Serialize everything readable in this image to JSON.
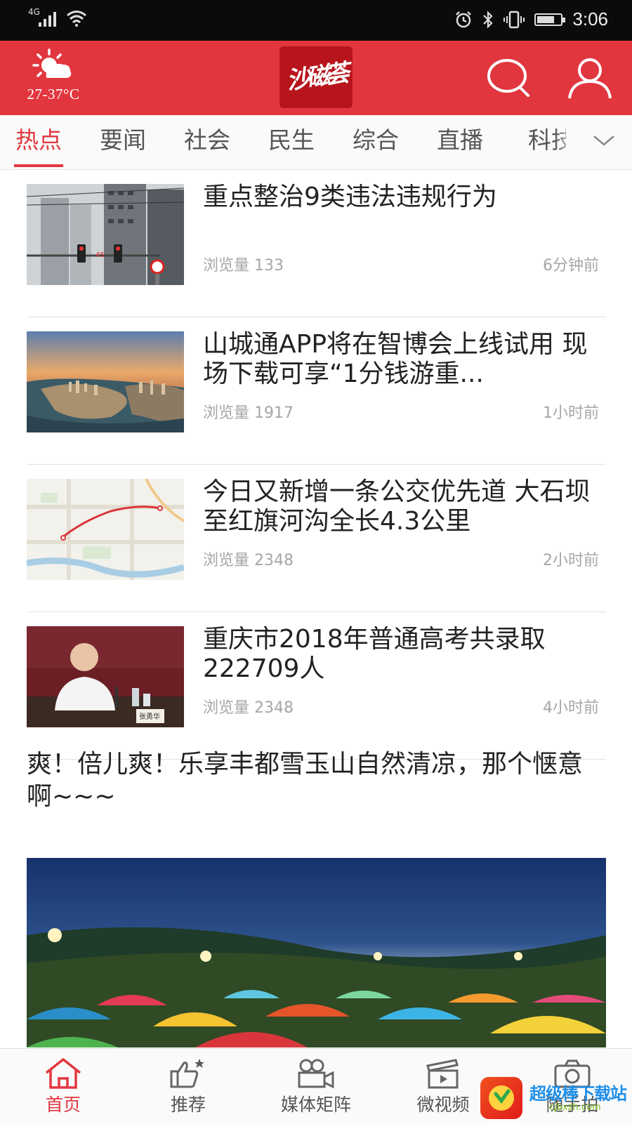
{
  "status_bar": {
    "network": "4G",
    "time": "3:06",
    "battery_level": 0.75
  },
  "header": {
    "weather_temp": "27-37°C",
    "weather_icon": "partly-sunny-icon",
    "logo_text": "沙磁荟",
    "search_icon": "search-icon",
    "user_icon": "user-icon",
    "colors": {
      "brand_red": "#e2363f",
      "logo_red": "#b8141c"
    }
  },
  "tabs": [
    {
      "label": "热点",
      "active": true
    },
    {
      "label": "要闻",
      "active": false
    },
    {
      "label": "社会",
      "active": false
    },
    {
      "label": "民生",
      "active": false
    },
    {
      "label": "综合",
      "active": false
    },
    {
      "label": "直播",
      "active": false
    },
    {
      "label": "科技",
      "active": false
    }
  ],
  "news": [
    {
      "title": "重点整治9类违法违规行为",
      "views": "浏览量 133",
      "time": "6分钟前"
    },
    {
      "title": "山城通APP将在智博会上线试用 现场下载可享“1分钱游重...",
      "views": "浏览量 1917",
      "time": "1小时前"
    },
    {
      "title": "今日又新增一条公交优先道 大石坝至红旗河沟全长4.3公里",
      "views": "浏览量 2348",
      "time": "2小时前"
    },
    {
      "title": "重庆市2018年普通高考共录取222709人",
      "views": "浏览量 2348",
      "time": "4小时前"
    }
  ],
  "featured": {
    "title": "爽！倍儿爽！乐享丰都雪玉山自然清凉，那个惬意啊~~~"
  },
  "bottom_nav": [
    {
      "label": "首页",
      "icon": "home-icon",
      "active": true
    },
    {
      "label": "推荐",
      "icon": "thumbs-up-icon",
      "active": false
    },
    {
      "label": "媒体矩阵",
      "icon": "video-camera-icon",
      "active": false
    },
    {
      "label": "微视频",
      "icon": "clapperboard-icon",
      "active": false
    },
    {
      "label": "随手拍",
      "icon": "camera-icon",
      "active": false
    }
  ],
  "watermark": {
    "text": "超级棒下载站",
    "url": "cjbxzh.com"
  }
}
